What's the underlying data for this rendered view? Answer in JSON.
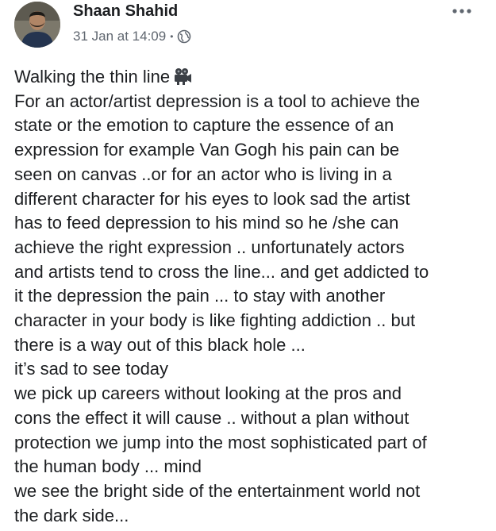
{
  "post": {
    "author": "Shaan Shahid",
    "timestamp": "31 Jan at 14:09",
    "separator": "•",
    "privacy_icon": "globe-icon",
    "more_icon": "more-options-icon",
    "title_line": "Walking the thin line",
    "title_emoji": "movie-camera-icon",
    "lines": [
      "For an actor/artist depression is a tool to achieve the",
      "state or the emotion to capture the essence of an",
      "expression  for example Van Gogh his pain can be",
      "seen on canvas ..or for an actor who is living in a",
      "different character  for his eyes to look sad the artist",
      "has to feed depression to his mind so he /she can",
      "achieve the right expression .. unfortunately actors",
      "and artists tend to cross the line... and get addicted to",
      "it the depression the pain ... to stay with another",
      "character in your body is like fighting addiction .. but",
      "there is a way out of this black hole ...",
      "it’s sad to see today",
      "we pick up careers without looking at the pros and",
      "cons the effect it will cause .. without a plan without",
      "protection we jump into the most sophisticated part of",
      "the human body ... mind",
      "we see the bright side of the entertainment world not",
      "the dark side..."
    ]
  },
  "colors": {
    "name": "#1c1e21",
    "meta": "#606770",
    "body_text": "#1c1e21",
    "background": "#ffffff"
  }
}
